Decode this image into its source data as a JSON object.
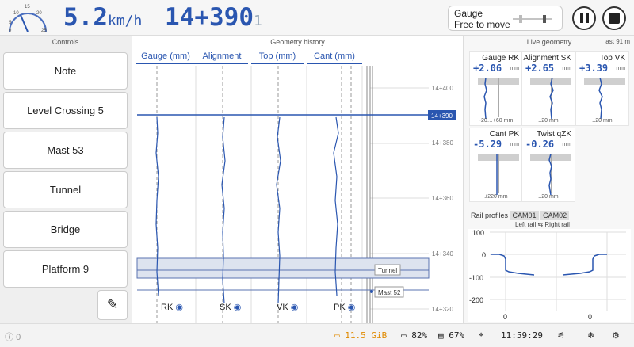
{
  "speed": {
    "value": "5.2",
    "unit": "km/h",
    "gauge_ticks": [
      "10",
      "15",
      "20",
      "5",
      "0",
      "25"
    ]
  },
  "kilometer": {
    "value": "14+390",
    "marker": "1"
  },
  "mode": {
    "line1": "Gauge",
    "line2": "Free to move"
  },
  "controls": {
    "title": "Controls",
    "notes": [
      "Note",
      "Level Crossing 5",
      "Mast 53",
      "Tunnel",
      "Bridge",
      "Platform 9"
    ]
  },
  "history": {
    "title": "Geometry history",
    "columns": [
      "Gauge (mm)",
      "Alignment",
      "Top (mm)",
      "Cant (mm)"
    ],
    "km_marks": [
      "14+400",
      "14+390",
      "14+380",
      "14+360",
      "14+340",
      "14+320"
    ],
    "events": [
      "Tunnel",
      "Mast 52"
    ],
    "toggles": [
      "RK",
      "SK",
      "VK",
      "PK"
    ]
  },
  "live": {
    "title": "Live geometry",
    "time": "last 91 m",
    "gauges": [
      {
        "name": "Gauge RK",
        "value": "+2.06",
        "unit": "mm",
        "scale": "-20…+60 mm"
      },
      {
        "name": "Alignment SK",
        "value": "+2.65",
        "unit": "mm",
        "scale": "±20 mm"
      },
      {
        "name": "Top VK",
        "value": "+3.39",
        "unit": "mm",
        "scale": "±20 mm"
      },
      {
        "name": "Cant PK",
        "value": "-5.29",
        "unit": "mm",
        "scale": "±220 mm"
      },
      {
        "name": "Twist qZK",
        "value": "-0.26",
        "unit": "mm",
        "scale": "±20 mm"
      }
    ]
  },
  "profiles": {
    "title": "Rail profiles",
    "cams": [
      "CAM01",
      "CAM02"
    ],
    "left": "Left rail",
    "right": "Right rail",
    "yticks": [
      "100",
      "0",
      "-100",
      "-200"
    ],
    "xticks": [
      "0",
      "0"
    ]
  },
  "status": {
    "count": "0",
    "memory": "11.5 GiB",
    "battery": "82%",
    "disk": "67%",
    "clock": "11:59:29"
  },
  "colors": {
    "accent": "#2a56b0",
    "warn": "#e08a00"
  }
}
